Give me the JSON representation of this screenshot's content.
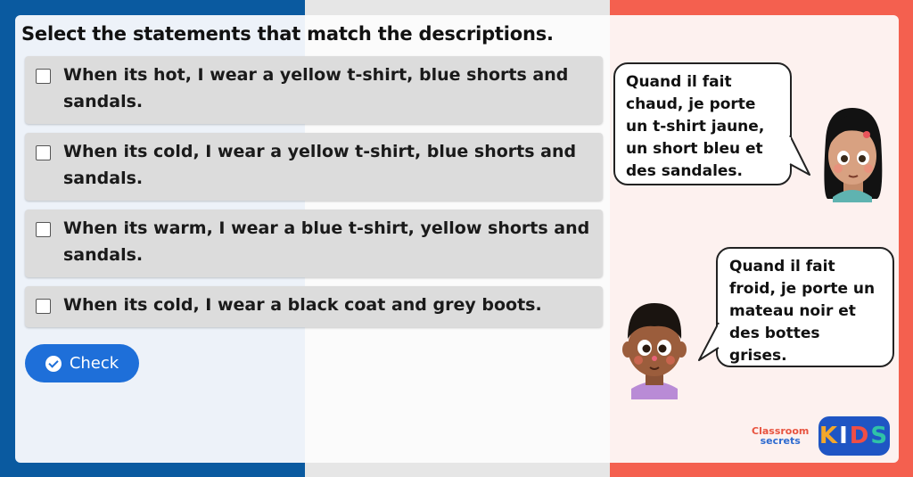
{
  "question": "Select the statements that match the descriptions.",
  "options": [
    {
      "label": "When its hot, I wear a yellow t-shirt, blue shorts and sandals.",
      "checked": false
    },
    {
      "label": "When its cold, I wear a yellow t-shirt, blue shorts and sandals.",
      "checked": false
    },
    {
      "label": "When its warm, I wear a blue t-shirt, yellow shorts and sandals.",
      "checked": false
    },
    {
      "label": "When its cold, I wear a black coat and grey boots.",
      "checked": false
    }
  ],
  "check_button": {
    "label": "Check",
    "icon": "check-circle-icon"
  },
  "speech": [
    {
      "speaker": "girl",
      "text": "Quand il fait chaud, je porte un t-shirt jaune, un short bleu et des sandales."
    },
    {
      "speaker": "boy",
      "text": "Quand il fait froid, je porte un mateau noir et des bottes grises."
    }
  ],
  "branding": {
    "classroom_line1": "Classroom",
    "classroom_line2": "secrets",
    "kids_k": "K",
    "kids_i": "I",
    "kids_d": "D",
    "kids_s": "S"
  },
  "colors": {
    "flag_blue": "#0a5aa0",
    "flag_white": "#e6e6e6",
    "flag_red": "#f4604f",
    "button_blue": "#1e6fd9"
  }
}
